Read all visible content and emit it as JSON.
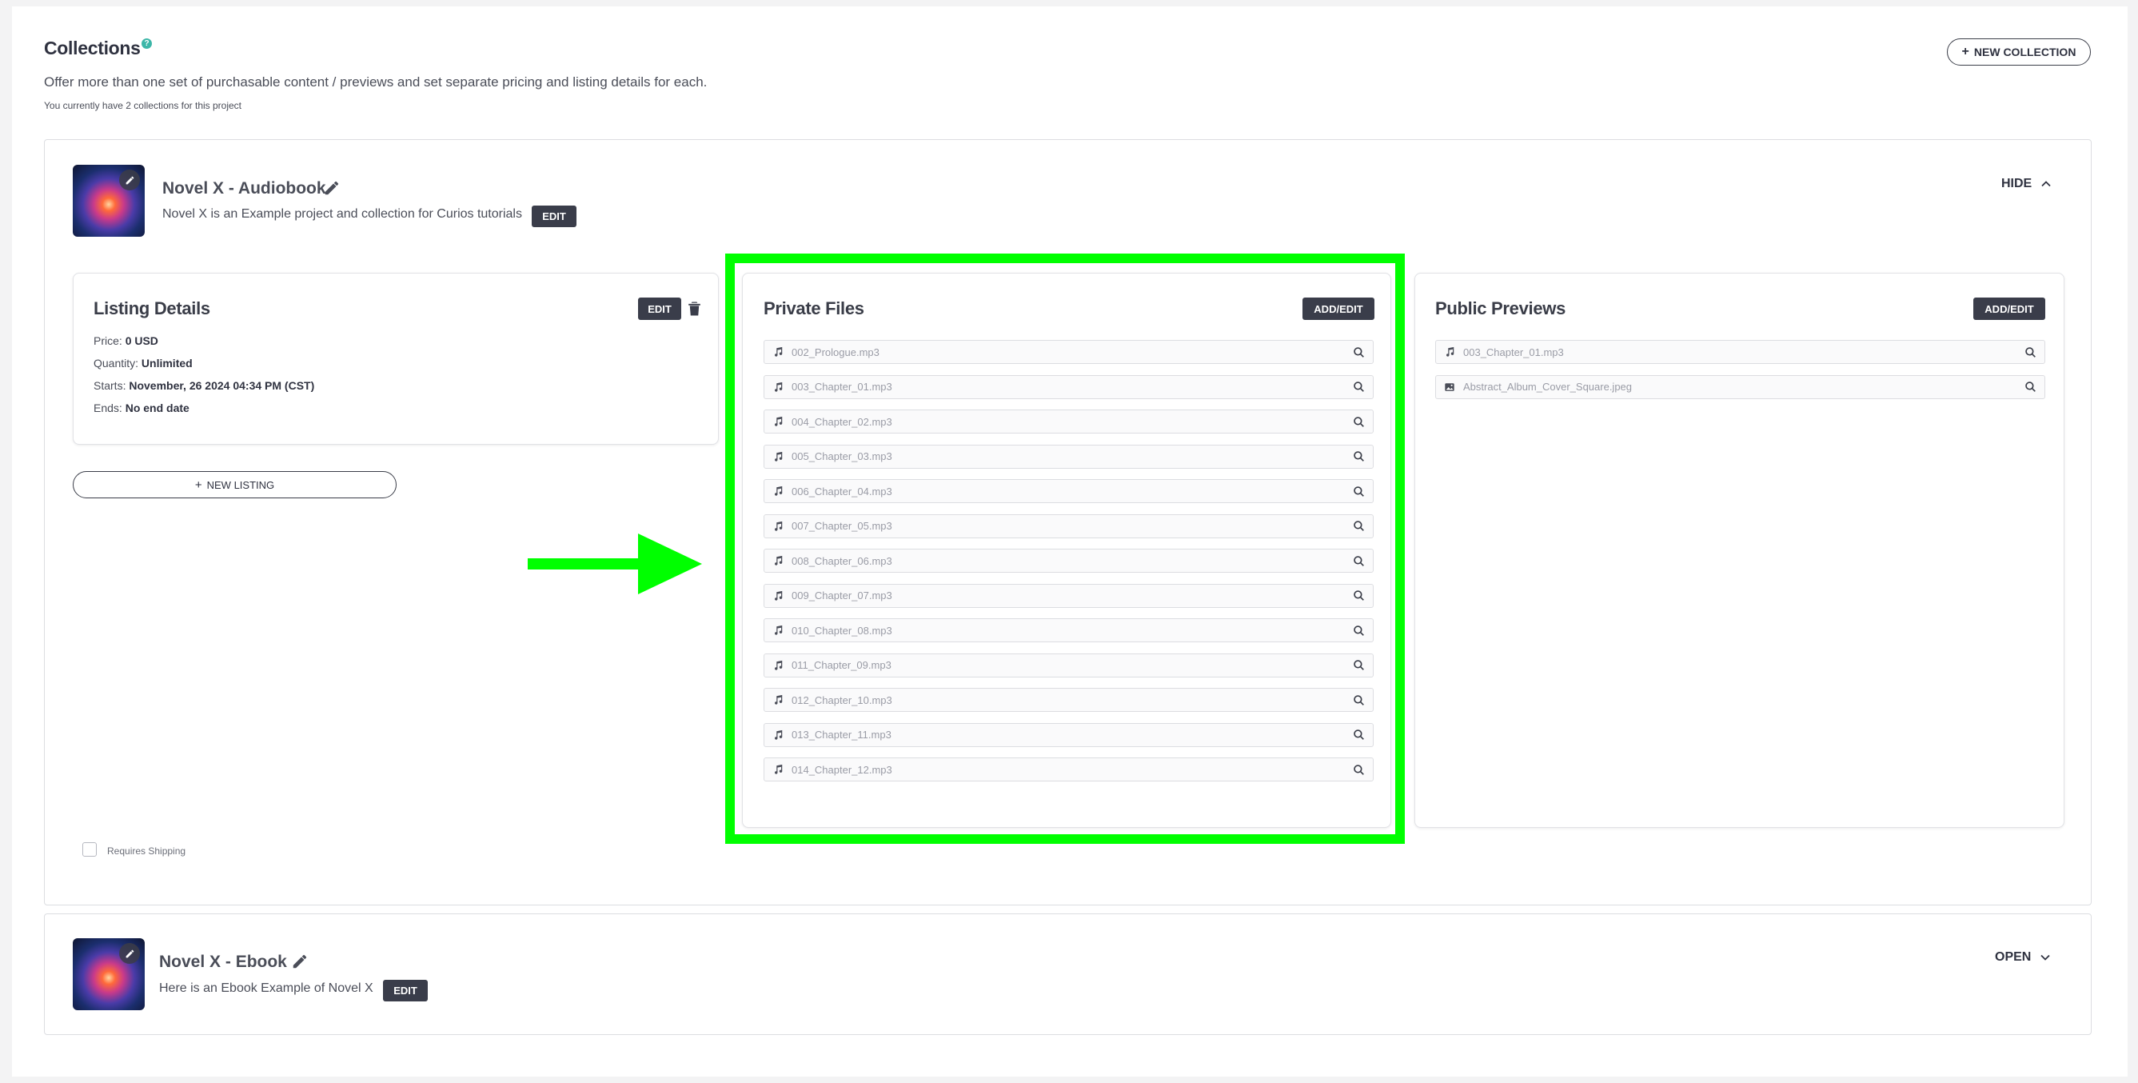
{
  "header": {
    "title": "Collections",
    "help_glyph": "?",
    "description": "Offer more than one set of purchasable content / previews and set separate pricing and listing details for each.",
    "count_text": "You currently have 2 collections for this project",
    "new_collection_label": "NEW COLLECTION"
  },
  "collections": [
    {
      "name": "Novel X - Audiobook",
      "description": "Novel X is an Example project and collection for Curios tutorials",
      "edit_label": "EDIT",
      "toggle_label": "HIDE",
      "listing": {
        "title": "Listing Details",
        "edit_label": "EDIT",
        "price_label": "Price:",
        "price_value": "0 USD",
        "quantity_label": "Quantity:",
        "quantity_value": "Unlimited",
        "starts_label": "Starts:",
        "starts_value": "November, 26 2024 04:34 PM (CST)",
        "ends_label": "Ends:",
        "ends_value": "No end date",
        "new_listing_label": "NEW LISTING"
      },
      "private_files": {
        "title": "Private Files",
        "button_label": "ADD/EDIT",
        "files": [
          {
            "name": "002_Prologue.mp3",
            "icon": "music-note-icon"
          },
          {
            "name": "003_Chapter_01.mp3",
            "icon": "music-note-icon"
          },
          {
            "name": "004_Chapter_02.mp3",
            "icon": "music-note-icon"
          },
          {
            "name": "005_Chapter_03.mp3",
            "icon": "music-note-icon"
          },
          {
            "name": "006_Chapter_04.mp3",
            "icon": "music-note-icon"
          },
          {
            "name": "007_Chapter_05.mp3",
            "icon": "music-note-icon"
          },
          {
            "name": "008_Chapter_06.mp3",
            "icon": "music-note-icon"
          },
          {
            "name": "009_Chapter_07.mp3",
            "icon": "music-note-icon"
          },
          {
            "name": "010_Chapter_08.mp3",
            "icon": "music-note-icon"
          },
          {
            "name": "011_Chapter_09.mp3",
            "icon": "music-note-icon"
          },
          {
            "name": "012_Chapter_10.mp3",
            "icon": "music-note-icon"
          },
          {
            "name": "013_Chapter_11.mp3",
            "icon": "music-note-icon"
          },
          {
            "name": "014_Chapter_12.mp3",
            "icon": "music-note-icon"
          }
        ]
      },
      "public_previews": {
        "title": "Public Previews",
        "button_label": "ADD/EDIT",
        "files": [
          {
            "name": "003_Chapter_01.mp3",
            "icon": "music-note-icon"
          },
          {
            "name": "Abstract_Album_Cover_Square.jpeg",
            "icon": "image-icon"
          }
        ]
      },
      "requires_shipping_label": "Requires Shipping"
    },
    {
      "name": "Novel X - Ebook",
      "description": "Here is an Ebook Example of Novel X",
      "edit_label": "EDIT",
      "toggle_label": "OPEN"
    }
  ],
  "colors": {
    "highlight": "#00ff00",
    "dark_button": "#3a3d4a",
    "help_accent": "#3cb6a8"
  }
}
